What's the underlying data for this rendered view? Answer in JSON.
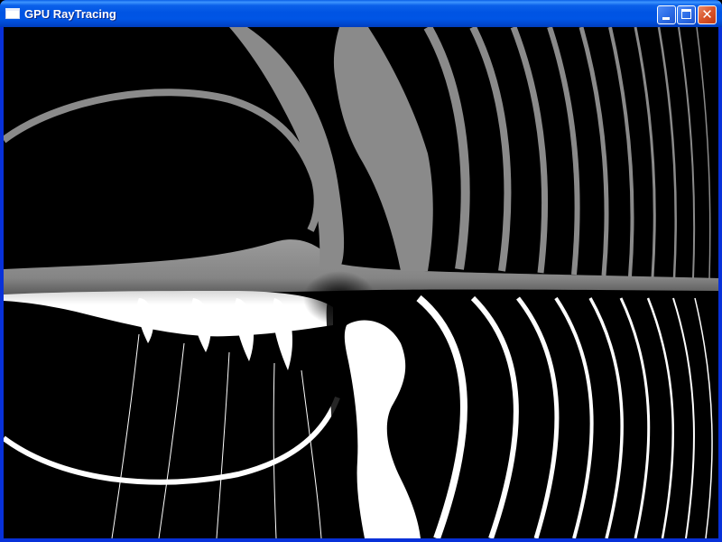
{
  "window": {
    "title": "GPU RayTracing",
    "icon": "window-icon",
    "controls": {
      "minimize_icon": "minimize-icon",
      "maximize_icon": "maximize-icon",
      "close_icon": "close-icon",
      "close_glyph": "✕"
    }
  },
  "viewport": {
    "content": "ray-traced-surface-render",
    "colors": {
      "background": "#000000",
      "gray_surface": "#8a8a8a",
      "white_surface": "#ffffff"
    }
  }
}
